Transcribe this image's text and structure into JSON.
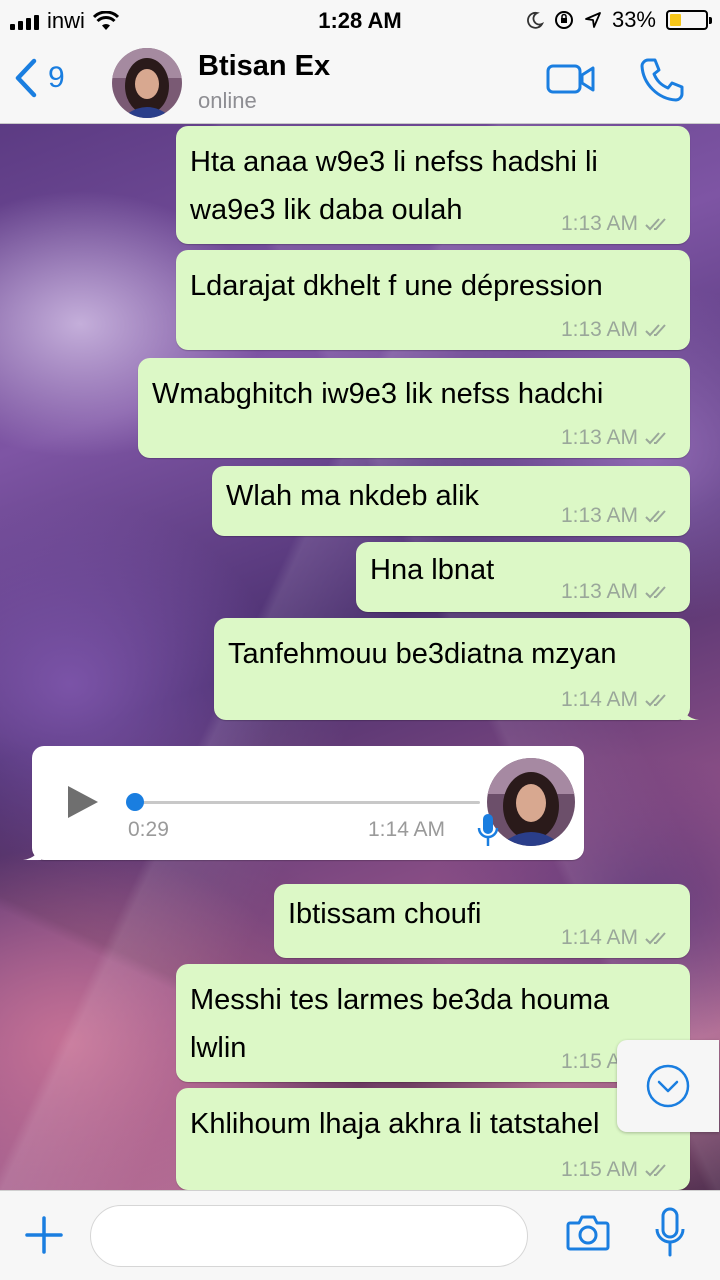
{
  "status_bar": {
    "carrier": "inwi",
    "time": "1:28 AM",
    "battery": "33%",
    "battery_level": 0.33
  },
  "header": {
    "back_count": "9",
    "contact_name": "Btisan Ex",
    "contact_status": "online",
    "icons": [
      "back-chevron-icon",
      "video-call-icon",
      "phone-call-icon"
    ]
  },
  "messages": [
    {
      "text_lines": [
        "Hta anaa w9e3 li nefss hadshi li",
        "wa9e3 lik daba oulah"
      ],
      "time": "1:13 AM"
    },
    {
      "text_lines": [
        "Ldarajat dkhelt f une dépression"
      ],
      "time": "1:13 AM"
    },
    {
      "text_lines": [
        "Wmabghitch iw9e3 lik nefss hadchi"
      ],
      "time": "1:13 AM"
    },
    {
      "text_lines": [
        "Wlah ma nkdeb alik"
      ],
      "time": "1:13 AM"
    },
    {
      "text_lines": [
        "Hna lbnat"
      ],
      "time": "1:13 AM"
    },
    {
      "text_lines": [
        "Tanfehmouu be3diatna mzyan"
      ],
      "time": "1:14 AM"
    },
    {
      "text_lines": [
        "Ibtissam choufi"
      ],
      "time": "1:14 AM"
    },
    {
      "text_lines": [
        "Messhi tes larmes be3da houma",
        "lwlin"
      ],
      "time": "1:15 AM"
    },
    {
      "text_lines": [
        "Khlihoum lhaja akhra li tatstahel"
      ],
      "time": "1:15 AM"
    }
  ],
  "voice_message": {
    "duration": "0:29",
    "time": "1:14 AM",
    "progress": 0.0
  },
  "input": {
    "placeholder": "",
    "icons": [
      "plus-icon",
      "camera-icon",
      "microphone-icon"
    ]
  },
  "colors": {
    "accent": "#1a7ee0",
    "outgoing_bubble": "#dcf8c6",
    "incoming_bubble": "#ffffff",
    "battery": "#f5c518"
  }
}
